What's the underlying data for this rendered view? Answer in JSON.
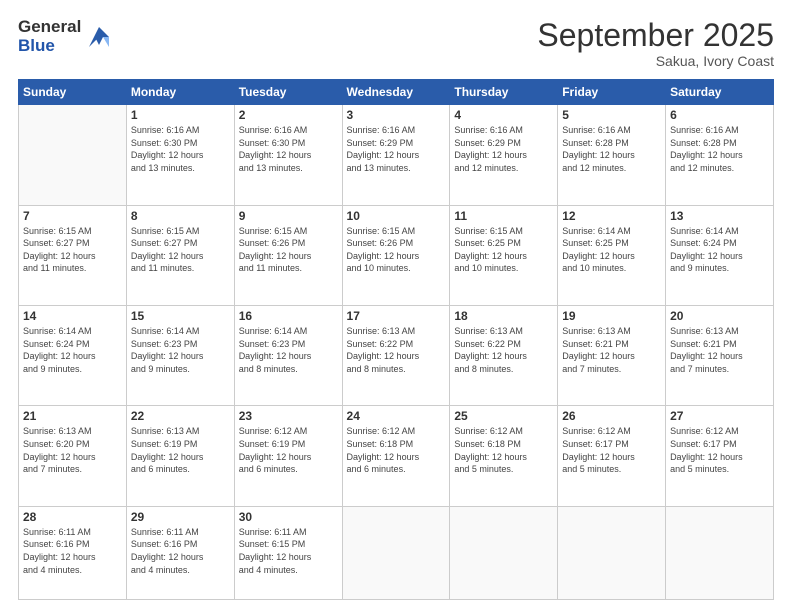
{
  "logo": {
    "general": "General",
    "blue": "Blue"
  },
  "header": {
    "month": "September 2025",
    "location": "Sakua, Ivory Coast"
  },
  "days_of_week": [
    "Sunday",
    "Monday",
    "Tuesday",
    "Wednesday",
    "Thursday",
    "Friday",
    "Saturday"
  ],
  "weeks": [
    [
      {
        "day": "",
        "info": ""
      },
      {
        "day": "1",
        "info": "Sunrise: 6:16 AM\nSunset: 6:30 PM\nDaylight: 12 hours\nand 13 minutes."
      },
      {
        "day": "2",
        "info": "Sunrise: 6:16 AM\nSunset: 6:30 PM\nDaylight: 12 hours\nand 13 minutes."
      },
      {
        "day": "3",
        "info": "Sunrise: 6:16 AM\nSunset: 6:29 PM\nDaylight: 12 hours\nand 13 minutes."
      },
      {
        "day": "4",
        "info": "Sunrise: 6:16 AM\nSunset: 6:29 PM\nDaylight: 12 hours\nand 12 minutes."
      },
      {
        "day": "5",
        "info": "Sunrise: 6:16 AM\nSunset: 6:28 PM\nDaylight: 12 hours\nand 12 minutes."
      },
      {
        "day": "6",
        "info": "Sunrise: 6:16 AM\nSunset: 6:28 PM\nDaylight: 12 hours\nand 12 minutes."
      }
    ],
    [
      {
        "day": "7",
        "info": "Sunrise: 6:15 AM\nSunset: 6:27 PM\nDaylight: 12 hours\nand 11 minutes."
      },
      {
        "day": "8",
        "info": "Sunrise: 6:15 AM\nSunset: 6:27 PM\nDaylight: 12 hours\nand 11 minutes."
      },
      {
        "day": "9",
        "info": "Sunrise: 6:15 AM\nSunset: 6:26 PM\nDaylight: 12 hours\nand 11 minutes."
      },
      {
        "day": "10",
        "info": "Sunrise: 6:15 AM\nSunset: 6:26 PM\nDaylight: 12 hours\nand 10 minutes."
      },
      {
        "day": "11",
        "info": "Sunrise: 6:15 AM\nSunset: 6:25 PM\nDaylight: 12 hours\nand 10 minutes."
      },
      {
        "day": "12",
        "info": "Sunrise: 6:14 AM\nSunset: 6:25 PM\nDaylight: 12 hours\nand 10 minutes."
      },
      {
        "day": "13",
        "info": "Sunrise: 6:14 AM\nSunset: 6:24 PM\nDaylight: 12 hours\nand 9 minutes."
      }
    ],
    [
      {
        "day": "14",
        "info": "Sunrise: 6:14 AM\nSunset: 6:24 PM\nDaylight: 12 hours\nand 9 minutes."
      },
      {
        "day": "15",
        "info": "Sunrise: 6:14 AM\nSunset: 6:23 PM\nDaylight: 12 hours\nand 9 minutes."
      },
      {
        "day": "16",
        "info": "Sunrise: 6:14 AM\nSunset: 6:23 PM\nDaylight: 12 hours\nand 8 minutes."
      },
      {
        "day": "17",
        "info": "Sunrise: 6:13 AM\nSunset: 6:22 PM\nDaylight: 12 hours\nand 8 minutes."
      },
      {
        "day": "18",
        "info": "Sunrise: 6:13 AM\nSunset: 6:22 PM\nDaylight: 12 hours\nand 8 minutes."
      },
      {
        "day": "19",
        "info": "Sunrise: 6:13 AM\nSunset: 6:21 PM\nDaylight: 12 hours\nand 7 minutes."
      },
      {
        "day": "20",
        "info": "Sunrise: 6:13 AM\nSunset: 6:21 PM\nDaylight: 12 hours\nand 7 minutes."
      }
    ],
    [
      {
        "day": "21",
        "info": "Sunrise: 6:13 AM\nSunset: 6:20 PM\nDaylight: 12 hours\nand 7 minutes."
      },
      {
        "day": "22",
        "info": "Sunrise: 6:13 AM\nSunset: 6:19 PM\nDaylight: 12 hours\nand 6 minutes."
      },
      {
        "day": "23",
        "info": "Sunrise: 6:12 AM\nSunset: 6:19 PM\nDaylight: 12 hours\nand 6 minutes."
      },
      {
        "day": "24",
        "info": "Sunrise: 6:12 AM\nSunset: 6:18 PM\nDaylight: 12 hours\nand 6 minutes."
      },
      {
        "day": "25",
        "info": "Sunrise: 6:12 AM\nSunset: 6:18 PM\nDaylight: 12 hours\nand 5 minutes."
      },
      {
        "day": "26",
        "info": "Sunrise: 6:12 AM\nSunset: 6:17 PM\nDaylight: 12 hours\nand 5 minutes."
      },
      {
        "day": "27",
        "info": "Sunrise: 6:12 AM\nSunset: 6:17 PM\nDaylight: 12 hours\nand 5 minutes."
      }
    ],
    [
      {
        "day": "28",
        "info": "Sunrise: 6:11 AM\nSunset: 6:16 PM\nDaylight: 12 hours\nand 4 minutes."
      },
      {
        "day": "29",
        "info": "Sunrise: 6:11 AM\nSunset: 6:16 PM\nDaylight: 12 hours\nand 4 minutes."
      },
      {
        "day": "30",
        "info": "Sunrise: 6:11 AM\nSunset: 6:15 PM\nDaylight: 12 hours\nand 4 minutes."
      },
      {
        "day": "",
        "info": ""
      },
      {
        "day": "",
        "info": ""
      },
      {
        "day": "",
        "info": ""
      },
      {
        "day": "",
        "info": ""
      }
    ]
  ]
}
